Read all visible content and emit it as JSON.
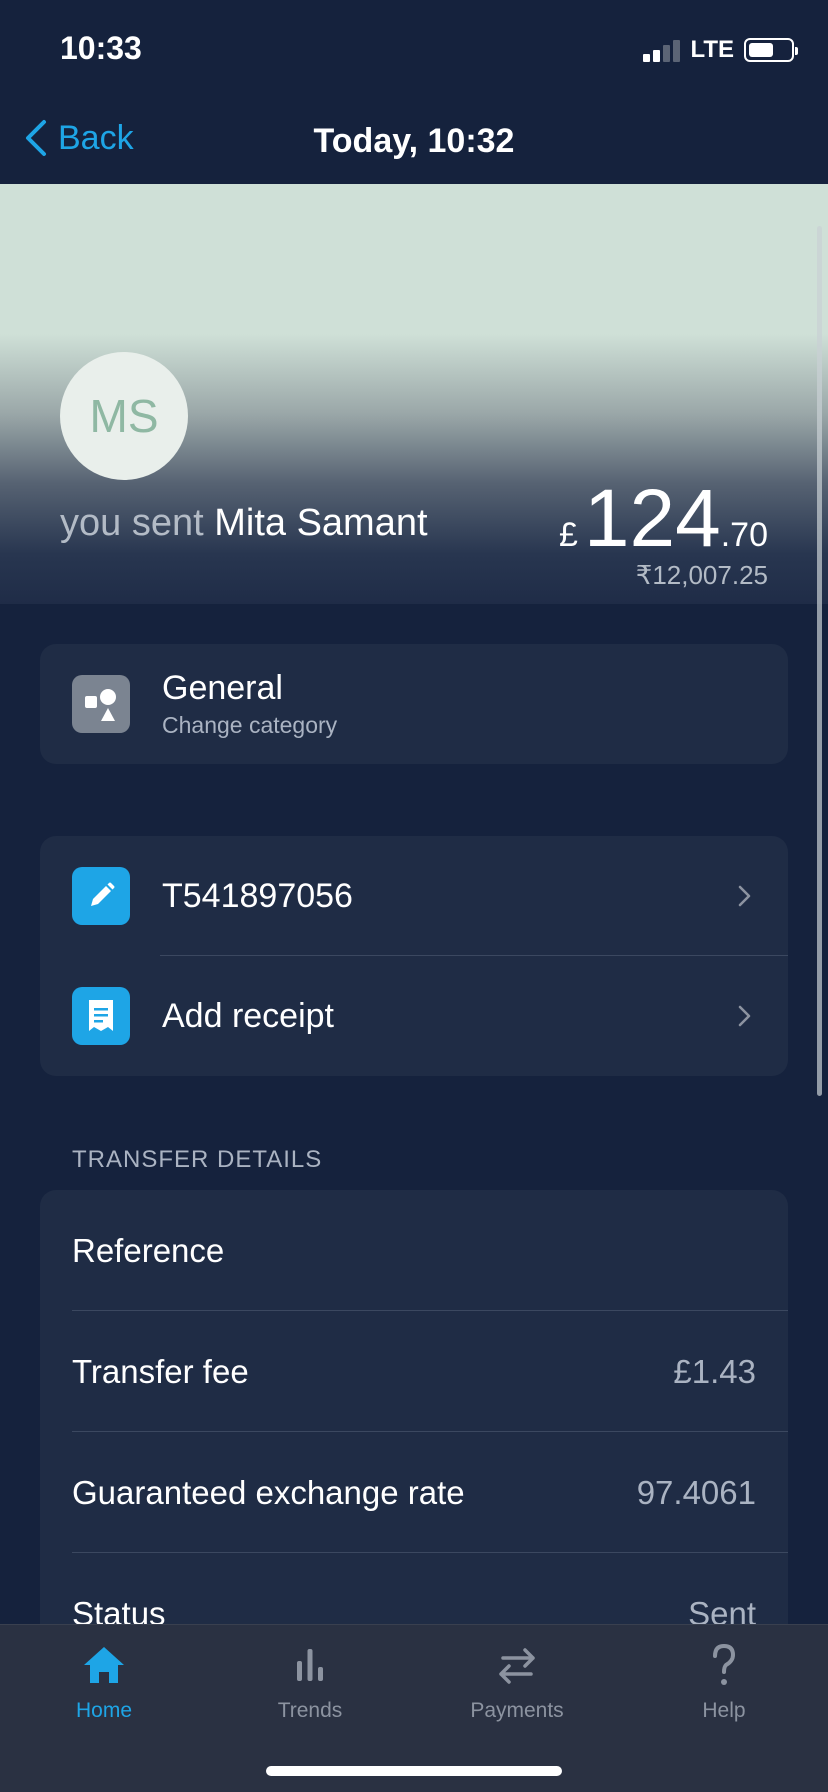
{
  "status_bar": {
    "time": "10:33",
    "network": "LTE"
  },
  "nav": {
    "back_label": "Back",
    "title": "Today, 10:32"
  },
  "transaction": {
    "avatar_initials": "MS",
    "sent_prefix": "you sent",
    "recipient": "Mita Samant",
    "currency_symbol": "£",
    "amount_whole": "124",
    "amount_decimal": ".70",
    "converted_amount": "₹12,007.25"
  },
  "category": {
    "title": "General",
    "subtitle": "Change category"
  },
  "actions": [
    {
      "label": "T541897056",
      "icon": "pencil-icon"
    },
    {
      "label": "Add receipt",
      "icon": "receipt-icon"
    }
  ],
  "details": {
    "section_label": "TRANSFER DETAILS",
    "rows": [
      {
        "label": "Reference",
        "value": ""
      },
      {
        "label": "Transfer fee",
        "value": "£1.43"
      },
      {
        "label": "Guaranteed exchange rate",
        "value": "97.4061"
      },
      {
        "label": "Status",
        "value": "Sent"
      }
    ]
  },
  "tabs": [
    {
      "label": "Home",
      "icon": "home-icon",
      "active": true
    },
    {
      "label": "Trends",
      "icon": "bar-chart-icon",
      "active": false
    },
    {
      "label": "Payments",
      "icon": "transfer-arrows-icon",
      "active": false
    },
    {
      "label": "Help",
      "icon": "question-icon",
      "active": false
    }
  ],
  "colors": {
    "accent": "#1ea5e6",
    "background": "#15223d",
    "card": "#1f2c45"
  }
}
